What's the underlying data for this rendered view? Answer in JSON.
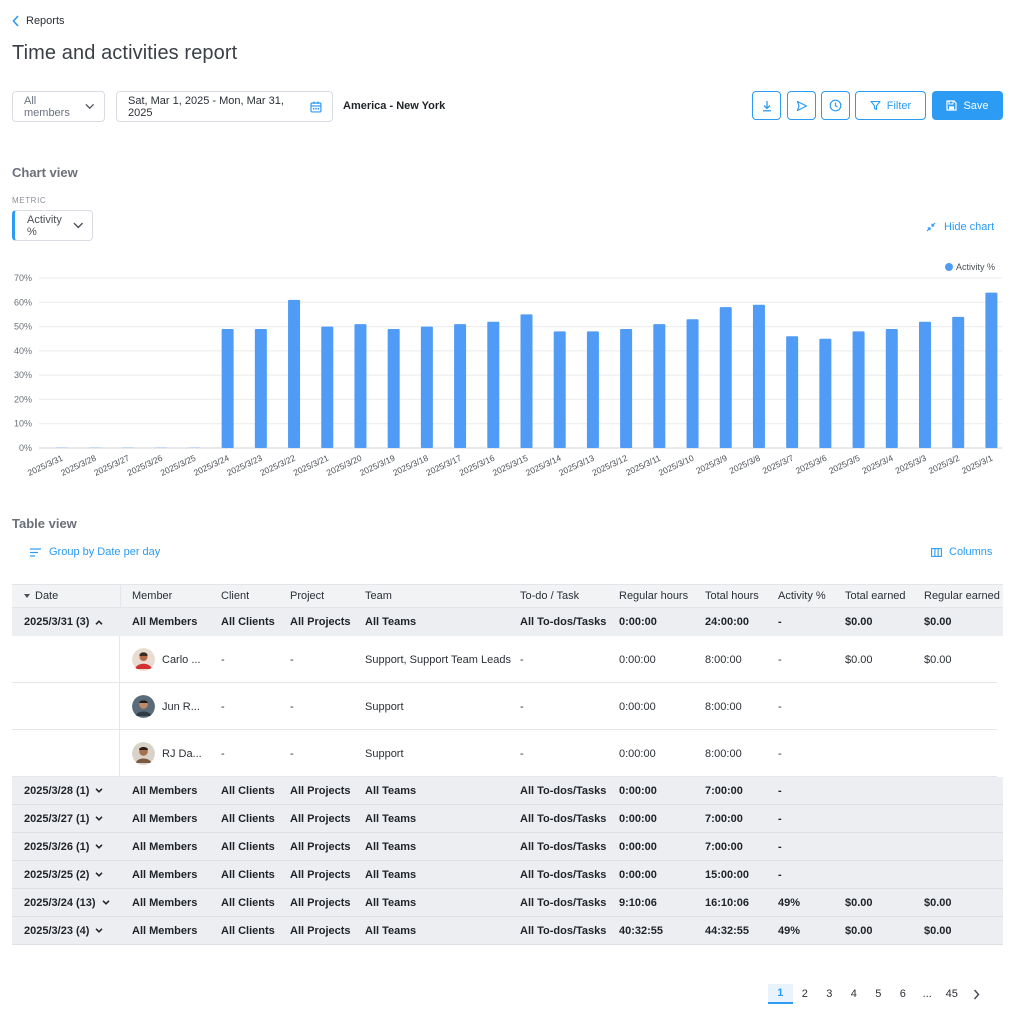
{
  "breadcrumb": {
    "label": "Reports"
  },
  "page_title": "Time and activities report",
  "filters": {
    "members": "All members",
    "date_range": "Sat, Mar 1, 2025 - Mon, Mar 31, 2025",
    "timezone": "America - New York"
  },
  "actions": {
    "download_icon": "download-icon",
    "send_icon": "send-icon",
    "schedule_icon": "clock-icon",
    "filter_label": "Filter",
    "save_label": "Save"
  },
  "chart_section": {
    "title": "Chart view",
    "metric_label": "METRIC",
    "metric_value": "Activity %",
    "hide_label": "Hide chart"
  },
  "colors": {
    "accent": "#2b9bf4",
    "bar": "#4f9bf5"
  },
  "chart_data": {
    "type": "bar",
    "categories": [
      "2025/3/31",
      "2025/3/28",
      "2025/3/27",
      "2025/3/26",
      "2025/3/25",
      "2025/3/24",
      "2025/3/23",
      "2025/3/22",
      "2025/3/21",
      "2025/3/20",
      "2025/3/19",
      "2025/3/18",
      "2025/3/17",
      "2025/3/16",
      "2025/3/15",
      "2025/3/14",
      "2025/3/13",
      "2025/3/12",
      "2025/3/11",
      "2025/3/10",
      "2025/3/9",
      "2025/3/8",
      "2025/3/7",
      "2025/3/6",
      "2025/3/5",
      "2025/3/4",
      "2025/3/3",
      "2025/3/2",
      "2025/3/1"
    ],
    "series": [
      {
        "name": "Activity %",
        "values": [
          0,
          0,
          0,
          0,
          0,
          49,
          49,
          61,
          50,
          51,
          49,
          50,
          51,
          52,
          55,
          48,
          48,
          49,
          51,
          53,
          58,
          59,
          46,
          45,
          48,
          49,
          52,
          54,
          64
        ]
      }
    ],
    "y_ticks": [
      "0%",
      "10%",
      "20%",
      "30%",
      "40%",
      "50%",
      "60%",
      "70%"
    ],
    "ylim": [
      0,
      70
    ],
    "grid": true,
    "legend": "top-right"
  },
  "table_section": {
    "title": "Table view",
    "group_by": "Group by Date per day",
    "columns_label": "Columns"
  },
  "table": {
    "headers": [
      "Date",
      "Member",
      "Client",
      "Project",
      "Team",
      "To-do / Task",
      "Regular hours",
      "Total hours",
      "Activity %",
      "Total earned",
      "Regular earned"
    ],
    "expanded_group": {
      "date": "2025/3/31 (3)",
      "member": "All Members",
      "client": "All Clients",
      "project": "All Projects",
      "team": "All Teams",
      "task": "All To-dos/Tasks",
      "regular_hours": "0:00:00",
      "total_hours": "24:00:00",
      "activity": "-",
      "total_earned": "$0.00",
      "regular_earned": "$0.00"
    },
    "detail_rows": [
      {
        "member": "Carlo ...",
        "client": "-",
        "project": "-",
        "team": "Support, Support Team Leads",
        "task": "-",
        "regular_hours": "0:00:00",
        "total_hours": "8:00:00",
        "activity": "-",
        "total_earned": "$0.00",
        "regular_earned": "$0.00"
      },
      {
        "member": "Jun R...",
        "client": "-",
        "project": "-",
        "team": "Support",
        "task": "-",
        "regular_hours": "0:00:00",
        "total_hours": "8:00:00",
        "activity": "-",
        "total_earned": "",
        "regular_earned": ""
      },
      {
        "member": "RJ Da...",
        "client": "-",
        "project": "-",
        "team": "Support",
        "task": "-",
        "regular_hours": "0:00:00",
        "total_hours": "8:00:00",
        "activity": "-",
        "total_earned": "",
        "regular_earned": ""
      }
    ],
    "groups": [
      {
        "date": "2025/3/28 (1)",
        "member": "All Members",
        "client": "All Clients",
        "project": "All Projects",
        "team": "All Teams",
        "task": "All To-dos/Tasks",
        "regular_hours": "0:00:00",
        "total_hours": "7:00:00",
        "activity": "-",
        "total_earned": "",
        "regular_earned": ""
      },
      {
        "date": "2025/3/27 (1)",
        "member": "All Members",
        "client": "All Clients",
        "project": "All Projects",
        "team": "All Teams",
        "task": "All To-dos/Tasks",
        "regular_hours": "0:00:00",
        "total_hours": "7:00:00",
        "activity": "-",
        "total_earned": "",
        "regular_earned": ""
      },
      {
        "date": "2025/3/26 (1)",
        "member": "All Members",
        "client": "All Clients",
        "project": "All Projects",
        "team": "All Teams",
        "task": "All To-dos/Tasks",
        "regular_hours": "0:00:00",
        "total_hours": "7:00:00",
        "activity": "-",
        "total_earned": "",
        "regular_earned": ""
      },
      {
        "date": "2025/3/25 (2)",
        "member": "All Members",
        "client": "All Clients",
        "project": "All Projects",
        "team": "All Teams",
        "task": "All To-dos/Tasks",
        "regular_hours": "0:00:00",
        "total_hours": "15:00:00",
        "activity": "-",
        "total_earned": "",
        "regular_earned": ""
      },
      {
        "date": "2025/3/24 (13)",
        "member": "All Members",
        "client": "All Clients",
        "project": "All Projects",
        "team": "All Teams",
        "task": "All To-dos/Tasks",
        "regular_hours": "9:10:06",
        "total_hours": "16:10:06",
        "activity": "49%",
        "total_earned": "$0.00",
        "regular_earned": "$0.00"
      },
      {
        "date": "2025/3/23 (4)",
        "member": "All Members",
        "client": "All Clients",
        "project": "All Projects",
        "team": "All Teams",
        "task": "All To-dos/Tasks",
        "regular_hours": "40:32:55",
        "total_hours": "44:32:55",
        "activity": "49%",
        "total_earned": "$0.00",
        "regular_earned": "$0.00"
      }
    ]
  },
  "pagination": {
    "pages": [
      "1",
      "2",
      "3",
      "4",
      "5",
      "6",
      "...",
      "45"
    ],
    "current": "1"
  }
}
